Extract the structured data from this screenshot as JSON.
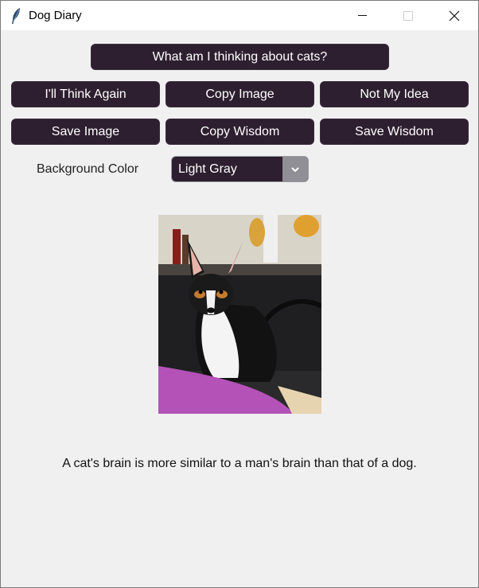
{
  "window": {
    "title": "Dog Diary"
  },
  "buttons": {
    "ask": "What am I thinking about cats?",
    "think_again": "I'll Think Again",
    "copy_image": "Copy Image",
    "not_my_idea": "Not My Idea",
    "save_image": "Save Image",
    "copy_wisdom": "Copy Wisdom",
    "save_wisdom": "Save Wisdom"
  },
  "background": {
    "label": "Background Color",
    "selected": "Light Gray"
  },
  "wisdom_text": "A cat's brain is more similar to a man's brain than that of a dog.",
  "icons": [
    "feather-icon",
    "minimize-icon",
    "maximize-icon",
    "close-icon",
    "chevron-down-icon"
  ],
  "colors": {
    "button_bg": "#2e1f30",
    "window_bg": "#f0f0f0",
    "button_text": "#ffffff"
  }
}
